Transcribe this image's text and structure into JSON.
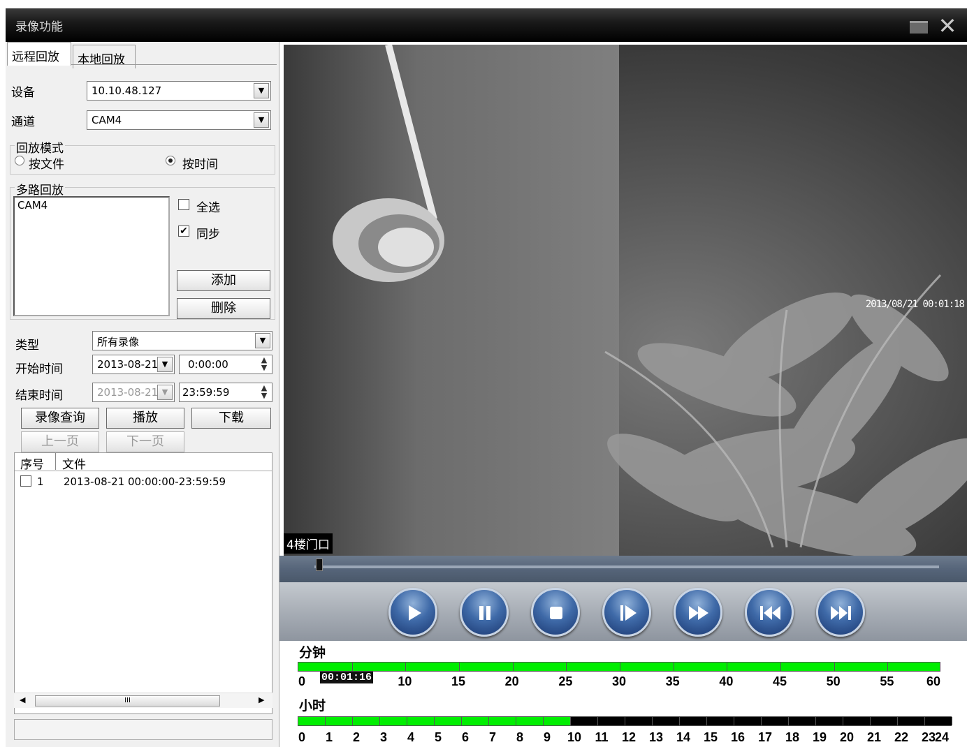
{
  "window": {
    "title": "录像功能"
  },
  "tabs": [
    {
      "label": "远程回放"
    },
    {
      "label": "本地回放"
    }
  ],
  "device": {
    "label": "设备",
    "value": "10.10.48.127"
  },
  "channel": {
    "label": "通道",
    "value": "CAM4"
  },
  "playback_mode": {
    "title": "回放模式",
    "by_file": "按文件",
    "by_time": "按时间",
    "selected": "按时间"
  },
  "multi_playback": {
    "title": "多路回放",
    "channels": [
      "CAM4"
    ],
    "select_all": "全选",
    "sync": "同步",
    "select_all_checked": false,
    "sync_checked": true,
    "add_label": "添加",
    "delete_label": "删除"
  },
  "query": {
    "type_label": "类型",
    "type_value": "所有录像",
    "start_label": "开始时间",
    "start_date": "2013-08-21",
    "start_time": "0:00:00",
    "end_label": "结束时间",
    "end_date": "2013-08-21",
    "end_time": "23:59:59"
  },
  "actions": {
    "search": "录像查询",
    "play": "播放",
    "download": "下载",
    "prev_page": "上一页",
    "next_page": "下一页"
  },
  "file_list": {
    "columns": [
      "序号",
      "文件"
    ],
    "rows": [
      {
        "index": "1",
        "file": "2013-08-21 00:00:00-23:59:59"
      }
    ]
  },
  "scrollbar_grip": "III",
  "video": {
    "timestamp": "2013/08/21 00:01:18",
    "camera_label": "4楼门口",
    "progress": 0.005
  },
  "controls": [
    "play-icon",
    "pause-icon",
    "stop-icon",
    "step-icon",
    "fast-forward-icon",
    "skip-back-icon",
    "skip-forward-icon"
  ],
  "timeline": {
    "minutes_title": "分钟",
    "hours_title": "小时",
    "current_time": "00:01:16",
    "minute_ticks": [
      "0",
      "10",
      "15",
      "20",
      "25",
      "30",
      "35",
      "40",
      "45",
      "50",
      "55",
      "60"
    ],
    "hour_ticks": [
      "0",
      "1",
      "2",
      "3",
      "4",
      "5",
      "6",
      "7",
      "8",
      "9",
      "10",
      "11",
      "12",
      "13",
      "14",
      "15",
      "16",
      "17",
      "18",
      "19",
      "20",
      "21",
      "22",
      "23",
      "24"
    ],
    "recorded_hours": 10,
    "colors": {
      "recorded": "#00ee00",
      "empty": "#000000"
    }
  }
}
